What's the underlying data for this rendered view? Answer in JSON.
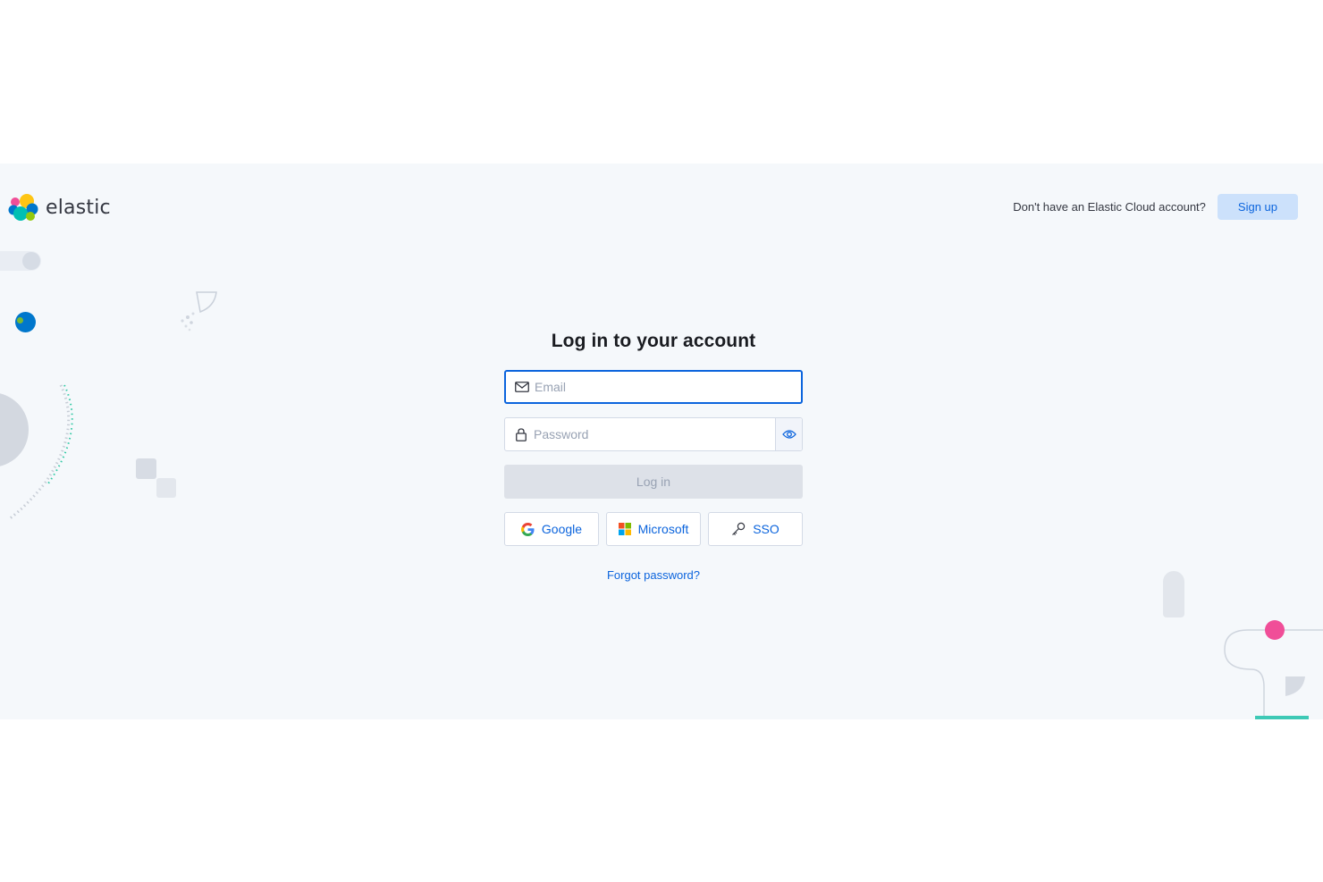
{
  "brand": {
    "name": "elastic",
    "colors": {
      "yellow": "#fec514",
      "pink": "#f04e98",
      "blue": "#0077cc",
      "teal": "#00bfb3",
      "green": "#93c90e"
    }
  },
  "header": {
    "signup_prompt": "Don't have an Elastic Cloud account?",
    "signup_label": "Sign up"
  },
  "form": {
    "title": "Log in to your account",
    "email": {
      "placeholder": "Email",
      "value": ""
    },
    "password": {
      "placeholder": "Password",
      "value": ""
    },
    "login_label": "Log in",
    "providers": [
      {
        "label": "Google",
        "icon": "google-icon"
      },
      {
        "label": "Microsoft",
        "icon": "microsoft-icon"
      },
      {
        "label": "SSO",
        "icon": "key-icon"
      }
    ],
    "forgot_label": "Forgot password?"
  },
  "colors": {
    "accent": "#0b64dd",
    "background": "#f5f8fb",
    "disabled": "#dde1e8"
  }
}
